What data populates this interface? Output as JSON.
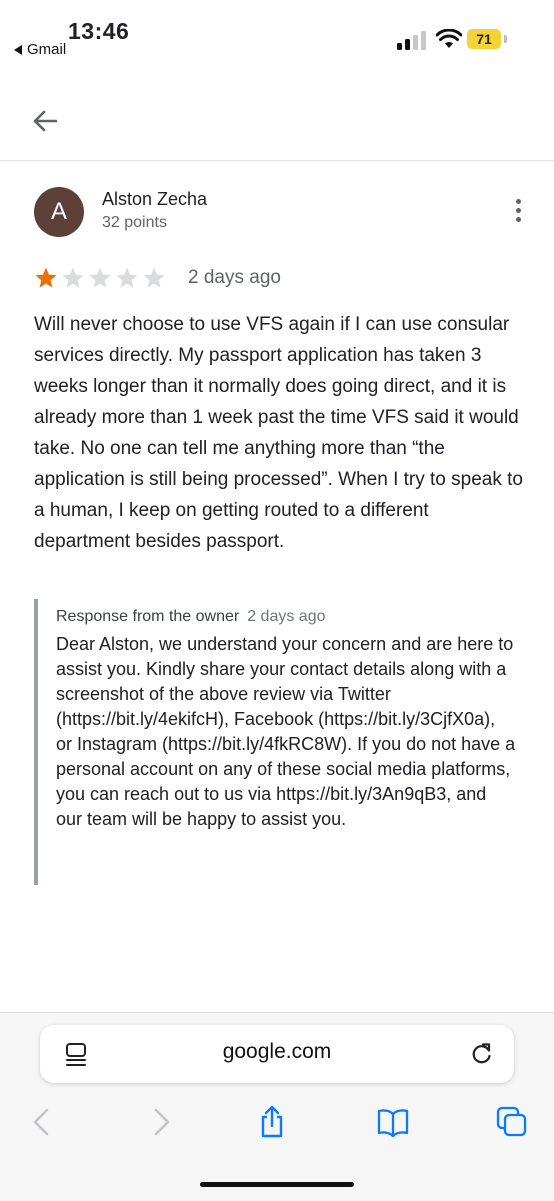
{
  "status_bar": {
    "time": "13:46",
    "back_app": "Gmail",
    "battery": "71"
  },
  "reviewer": {
    "avatar_letter": "A",
    "name": "Alston Zecha",
    "points": "32 points"
  },
  "rating": {
    "stars_filled": 1,
    "stars_total": 5,
    "date": "2 days ago"
  },
  "review": {
    "text": "Will never choose to use VFS again if I can use consular services directly. My passport application has taken 3 weeks longer than it normally does going direct, and it is already more than 1 week past the time VFS said it would take. No one can tell me anything more than “the application is still being processed”. When I try to speak to a human, I keep on getting routed to a different department besides passport."
  },
  "owner_response": {
    "label": "Response from the owner",
    "date": "2 days ago",
    "text": "Dear Alston, we understand your concern and are here to assist you. Kindly share your contact details along with a screenshot of the above review via Twitter (https://bit.ly/4ekifcH), Facebook (https://bit.ly/3CjfX0a), or Instagram (https://bit.ly/4fkRC8W). If you do not have a personal account on any of these social media platforms, you can reach out to us via https://bit.ly/3An9qB3, and our team will be happy to assist you."
  },
  "browser": {
    "url": "google.com"
  },
  "colors": {
    "star_filled": "#e8710a",
    "star_empty": "#dadce0",
    "ios_blue": "#0a7aff",
    "avatar_bg": "#5d4037"
  },
  "icons": [
    "back-arrow-icon",
    "more-vert-icon",
    "star-icon",
    "reader-icon",
    "reload-icon",
    "chevron-left-icon",
    "chevron-right-icon",
    "share-icon",
    "bookmarks-icon",
    "tabs-icon"
  ]
}
